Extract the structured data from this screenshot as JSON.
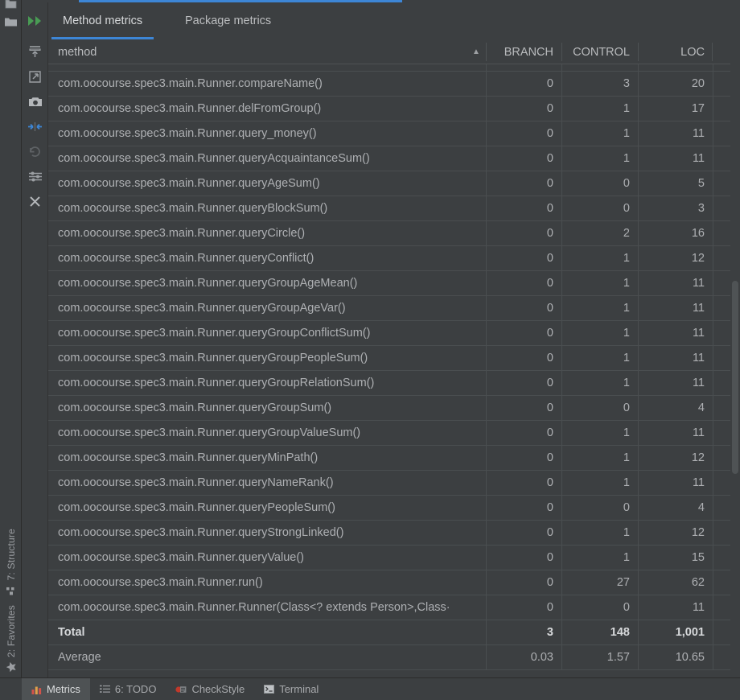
{
  "window": {
    "left_strip": {
      "top_icons": [
        {
          "name": "project-folder-icon",
          "glyph": "folder"
        }
      ],
      "bottom_tabs": [
        {
          "name": "sidebar-tab-structure",
          "label": "7: Structure",
          "icon": "structure-icon"
        },
        {
          "name": "sidebar-tab-favorites",
          "label": "2: Favorites",
          "icon": "star-icon"
        }
      ]
    },
    "toolwindow_buttons": [
      {
        "name": "run-metrics-button",
        "icon": "double-green-arrow-icon",
        "enabled": true
      },
      {
        "name": "collapse-all-button",
        "icon": "collapse-to-top-icon",
        "enabled": true
      },
      {
        "name": "expand-button",
        "icon": "expand-arrow-icon",
        "enabled": true
      },
      {
        "name": "snapshot-button",
        "icon": "camera-icon",
        "enabled": true
      },
      {
        "name": "diff-button",
        "icon": "compare-arrows-icon",
        "enabled": true,
        "active": true
      },
      {
        "name": "undo-button",
        "icon": "undo-icon",
        "enabled": false
      },
      {
        "name": "settings-button",
        "icon": "sliders-icon",
        "enabled": true
      },
      {
        "name": "close-button",
        "icon": "close-x-icon",
        "enabled": true
      }
    ],
    "tabs": [
      {
        "name": "tab-method-metrics",
        "label": "Method metrics",
        "active": true
      },
      {
        "name": "tab-package-metrics",
        "label": "Package metrics",
        "active": false
      }
    ]
  },
  "accent_color": "#3d86d6",
  "table": {
    "sort": {
      "column": "method",
      "direction": "ascending",
      "glyph": "▲"
    },
    "columns": [
      {
        "key": "method",
        "label": "method",
        "align": "left"
      },
      {
        "key": "branch",
        "label": "BRANCH",
        "align": "right"
      },
      {
        "key": "control",
        "label": "CONTROL",
        "align": "right"
      },
      {
        "key": "loc",
        "label": "LOC",
        "align": "right"
      }
    ],
    "clipped_top_row": true,
    "rows": [
      {
        "method": "com.oocourse.spec3.main.Runner.compareName()",
        "branch": "0",
        "control": "3",
        "loc": "20"
      },
      {
        "method": "com.oocourse.spec3.main.Runner.delFromGroup()",
        "branch": "0",
        "control": "1",
        "loc": "17"
      },
      {
        "method": "com.oocourse.spec3.main.Runner.query_money()",
        "branch": "0",
        "control": "1",
        "loc": "11"
      },
      {
        "method": "com.oocourse.spec3.main.Runner.queryAcquaintanceSum()",
        "branch": "0",
        "control": "1",
        "loc": "11"
      },
      {
        "method": "com.oocourse.spec3.main.Runner.queryAgeSum()",
        "branch": "0",
        "control": "0",
        "loc": "5"
      },
      {
        "method": "com.oocourse.spec3.main.Runner.queryBlockSum()",
        "branch": "0",
        "control": "0",
        "loc": "3"
      },
      {
        "method": "com.oocourse.spec3.main.Runner.queryCircle()",
        "branch": "0",
        "control": "2",
        "loc": "16"
      },
      {
        "method": "com.oocourse.spec3.main.Runner.queryConflict()",
        "branch": "0",
        "control": "1",
        "loc": "12"
      },
      {
        "method": "com.oocourse.spec3.main.Runner.queryGroupAgeMean()",
        "branch": "0",
        "control": "1",
        "loc": "11"
      },
      {
        "method": "com.oocourse.spec3.main.Runner.queryGroupAgeVar()",
        "branch": "0",
        "control": "1",
        "loc": "11"
      },
      {
        "method": "com.oocourse.spec3.main.Runner.queryGroupConflictSum()",
        "branch": "0",
        "control": "1",
        "loc": "11"
      },
      {
        "method": "com.oocourse.spec3.main.Runner.queryGroupPeopleSum()",
        "branch": "0",
        "control": "1",
        "loc": "11"
      },
      {
        "method": "com.oocourse.spec3.main.Runner.queryGroupRelationSum()",
        "branch": "0",
        "control": "1",
        "loc": "11"
      },
      {
        "method": "com.oocourse.spec3.main.Runner.queryGroupSum()",
        "branch": "0",
        "control": "0",
        "loc": "4"
      },
      {
        "method": "com.oocourse.spec3.main.Runner.queryGroupValueSum()",
        "branch": "0",
        "control": "1",
        "loc": "11"
      },
      {
        "method": "com.oocourse.spec3.main.Runner.queryMinPath()",
        "branch": "0",
        "control": "1",
        "loc": "12"
      },
      {
        "method": "com.oocourse.spec3.main.Runner.queryNameRank()",
        "branch": "0",
        "control": "1",
        "loc": "11"
      },
      {
        "method": "com.oocourse.spec3.main.Runner.queryPeopleSum()",
        "branch": "0",
        "control": "0",
        "loc": "4"
      },
      {
        "method": "com.oocourse.spec3.main.Runner.queryStrongLinked()",
        "branch": "0",
        "control": "1",
        "loc": "12"
      },
      {
        "method": "com.oocourse.spec3.main.Runner.queryValue()",
        "branch": "0",
        "control": "1",
        "loc": "15"
      },
      {
        "method": "com.oocourse.spec3.main.Runner.run()",
        "branch": "0",
        "control": "27",
        "loc": "62"
      },
      {
        "method": "com.oocourse.spec3.main.Runner.Runner(Class<? extends Person>,Class·",
        "branch": "0",
        "control": "0",
        "loc": "11"
      }
    ],
    "summary": [
      {
        "kind": "total",
        "label": "Total",
        "branch": "3",
        "control": "148",
        "loc": "1,001"
      },
      {
        "kind": "average",
        "label": "Average",
        "branch": "0.03",
        "control": "1.57",
        "loc": "10.65"
      }
    ]
  },
  "statusbar": {
    "items": [
      {
        "name": "statusbar-metrics",
        "label": "Metrics",
        "icon": "bar-chart-icon",
        "active": true
      },
      {
        "name": "statusbar-todo",
        "label": "6: TODO",
        "icon": "todo-list-icon",
        "active": false
      },
      {
        "name": "statusbar-checkstyle",
        "label": "CheckStyle",
        "icon": "checkstyle-icon",
        "active": false
      },
      {
        "name": "statusbar-terminal",
        "label": "Terminal",
        "icon": "terminal-icon",
        "active": false
      }
    ]
  }
}
